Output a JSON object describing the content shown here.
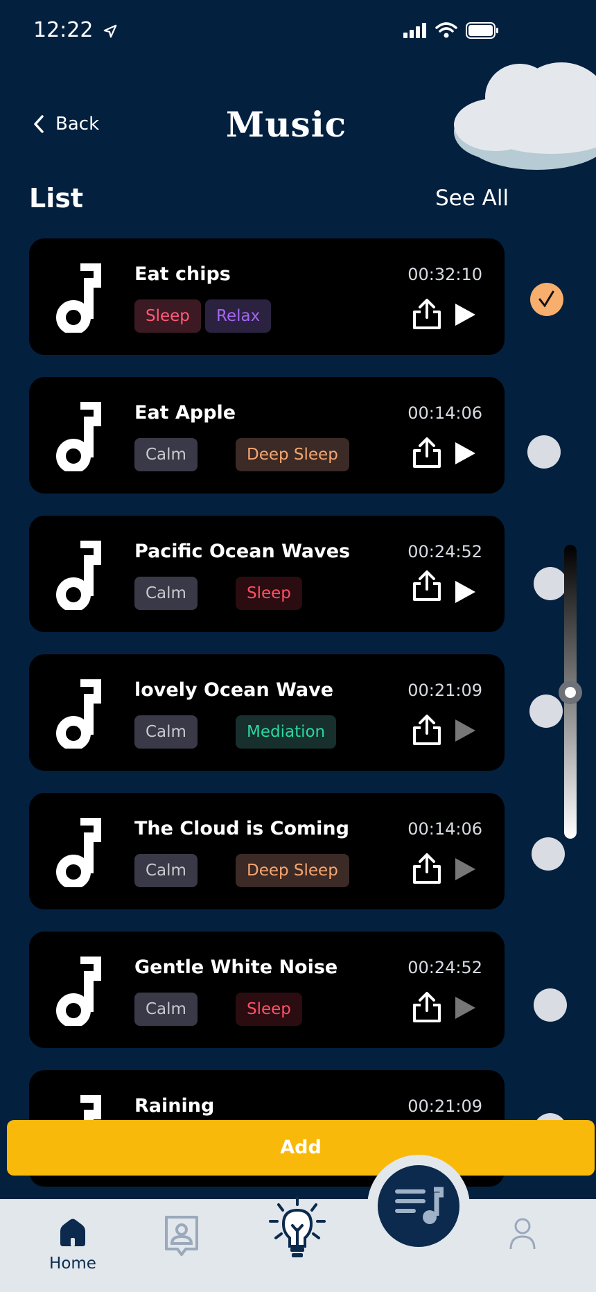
{
  "status_bar": {
    "time": "12:22"
  },
  "header": {
    "back_label": "Back",
    "title": "Music"
  },
  "section": {
    "title": "List",
    "see_all": "See All"
  },
  "tracks": [
    {
      "name": "Eat chips",
      "duration": "00:32:10",
      "tags": [
        "Sleep",
        "Relax"
      ],
      "selected": true
    },
    {
      "name": "Eat Apple",
      "duration": "00:14:06",
      "tags": [
        "Calm",
        "Deep Sleep"
      ],
      "selected": false
    },
    {
      "name": "Pacific Ocean Waves",
      "duration": "00:24:52",
      "tags": [
        "Calm",
        "Sleep"
      ],
      "selected": false
    },
    {
      "name": "lovely Ocean Wave",
      "duration": "00:21:09",
      "tags": [
        "Calm",
        "Mediation"
      ],
      "selected": false
    },
    {
      "name": "The Cloud is Coming",
      "duration": "00:14:06",
      "tags": [
        "Calm",
        "Deep Sleep"
      ],
      "selected": false
    },
    {
      "name": "Gentle White Noise",
      "duration": "00:24:52",
      "tags": [
        "Calm",
        "Sleep"
      ],
      "selected": false
    },
    {
      "name": "Raining",
      "duration": "00:21:09",
      "tags": [],
      "selected": false
    }
  ],
  "add_button": {
    "label": "Add"
  },
  "bottom_nav": {
    "home_label": "Home"
  },
  "colors": {
    "background": "#03203f",
    "accent_yellow": "#f9b90b",
    "checked_orange": "#f8ae6c"
  },
  "icons": [
    "location-arrow-icon",
    "signal-icon",
    "wifi-icon",
    "battery-icon",
    "chevron-left-icon",
    "cloud-icon",
    "music-note-icon",
    "share-icon",
    "play-icon",
    "check-icon",
    "home-icon",
    "contact-icon",
    "lightbulb-icon",
    "playlist-icon",
    "user-icon"
  ]
}
